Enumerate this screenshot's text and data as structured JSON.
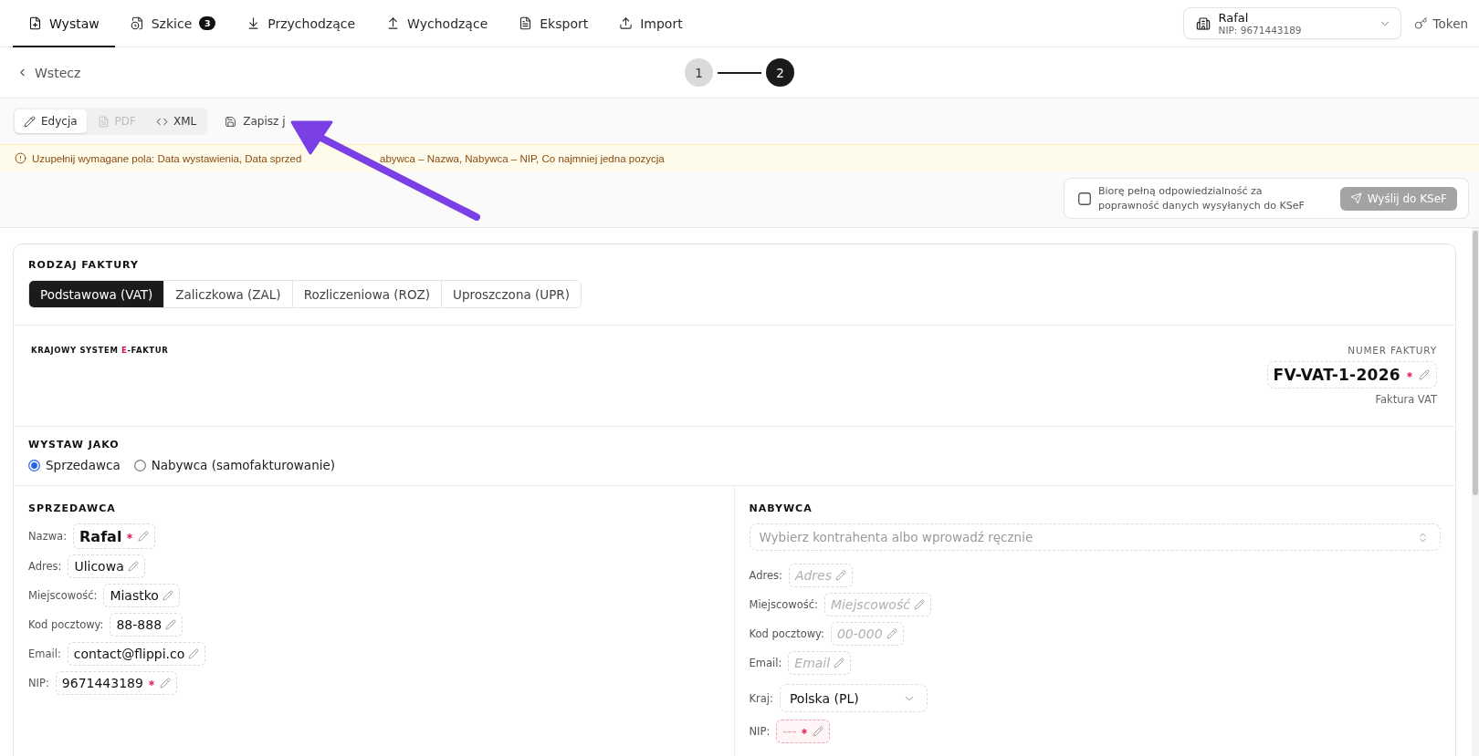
{
  "nav": {
    "tabs": [
      {
        "label": "Wystaw",
        "selected": true
      },
      {
        "label": "Szkice",
        "badge": "3",
        "selected": false
      },
      {
        "label": "Przychodzące",
        "selected": false
      },
      {
        "label": "Wychodzące",
        "selected": false
      },
      {
        "label": "Eksport",
        "selected": false
      },
      {
        "label": "Import",
        "selected": false
      }
    ],
    "account": {
      "name": "Rafal",
      "nip": "NIP: 9671443189"
    },
    "token": "Token"
  },
  "subheader": {
    "back": "Wstecz",
    "steps": [
      {
        "label": "1",
        "selected": false
      },
      {
        "label": "2",
        "selected": true
      }
    ]
  },
  "toolbar": {
    "views": [
      {
        "label": "Edycja",
        "selected": true,
        "disabled": false
      },
      {
        "label": "PDF",
        "selected": false,
        "disabled": true
      },
      {
        "label": "XML",
        "selected": false,
        "disabled": false
      }
    ],
    "save": "Zapisz j"
  },
  "warning": {
    "parts": [
      "Uzupełnij wymagane pola: Data wystawienia, Data sprzed",
      "abywca – Nazwa, Nabywca – NIP, Co najmniej jedna pozycja"
    ]
  },
  "submit": {
    "consent": {
      "label": "Biorę pełną odpowiedzialność za poprawność danych wysyłanych do KSeF",
      "checked": false
    },
    "send": {
      "label": "Wyślij do KSeF",
      "disabled": true
    }
  },
  "invoice": {
    "type": {
      "title": "RODZAJ FAKTURY",
      "options": [
        {
          "label": "Podstawowa (VAT)",
          "selected": true
        },
        {
          "label": "Zaliczkowa (ZAL)",
          "selected": false
        },
        {
          "label": "Rozliczeniowa (ROZ)",
          "selected": false
        },
        {
          "label": "Uproszczona (UPR)",
          "selected": false
        }
      ]
    },
    "header": {
      "logo": {
        "before": "KRAJOWY SYSTEM",
        "accent": "E",
        "after": "-FAKTUR"
      },
      "number": {
        "label": "NUMER FAKTURY",
        "value": "FV-VAT-1-2026",
        "required": true
      },
      "subtitle": "Faktura VAT"
    },
    "issue_as": {
      "title": "WYSTAW JAKO",
      "options": [
        {
          "label": "Sprzedawca",
          "selected": true
        },
        {
          "label": "Nabywca (samofakturowanie)",
          "selected": false
        }
      ]
    },
    "seller": {
      "title": "SPRZEDAWCA",
      "fields": [
        {
          "kind": "name",
          "label": "Nazwa:",
          "value": "Rafal",
          "required": true
        },
        {
          "kind": "text",
          "label": "Adres:",
          "value": "Ulicowa",
          "required": false
        },
        {
          "kind": "text",
          "label": "Miejscowość:",
          "value": "Miastko",
          "required": false
        },
        {
          "kind": "text",
          "label": "Kod pocztowy:",
          "value": "88-888",
          "required": false
        },
        {
          "kind": "text",
          "label": "Email:",
          "value": "contact@flippi.co",
          "required": false
        },
        {
          "kind": "text",
          "label": "NIP:",
          "value": "9671443189",
          "required": true
        }
      ]
    },
    "buyer": {
      "title": "NABYWCA",
      "contractor": {
        "placeholder": "Wybierz kontrahenta albo wprowadź ręcznie"
      },
      "fields": [
        {
          "kind": "text",
          "label": "Adres:",
          "placeholder": "Adres",
          "required": false,
          "invalid": false
        },
        {
          "kind": "text",
          "label": "Miejscowość:",
          "placeholder": "Miejscowość",
          "required": false,
          "invalid": false
        },
        {
          "kind": "text",
          "label": "Kod pocztowy:",
          "placeholder": "00-000",
          "required": false,
          "invalid": false
        },
        {
          "kind": "text",
          "label": "Email:",
          "placeholder": "Email",
          "required": false,
          "invalid": false
        },
        {
          "kind": "select",
          "label": "Kraj:",
          "value": "Polska (PL)"
        },
        {
          "kind": "text",
          "label": "NIP:",
          "placeholder": "---",
          "required": true,
          "invalid": true
        }
      ]
    }
  }
}
